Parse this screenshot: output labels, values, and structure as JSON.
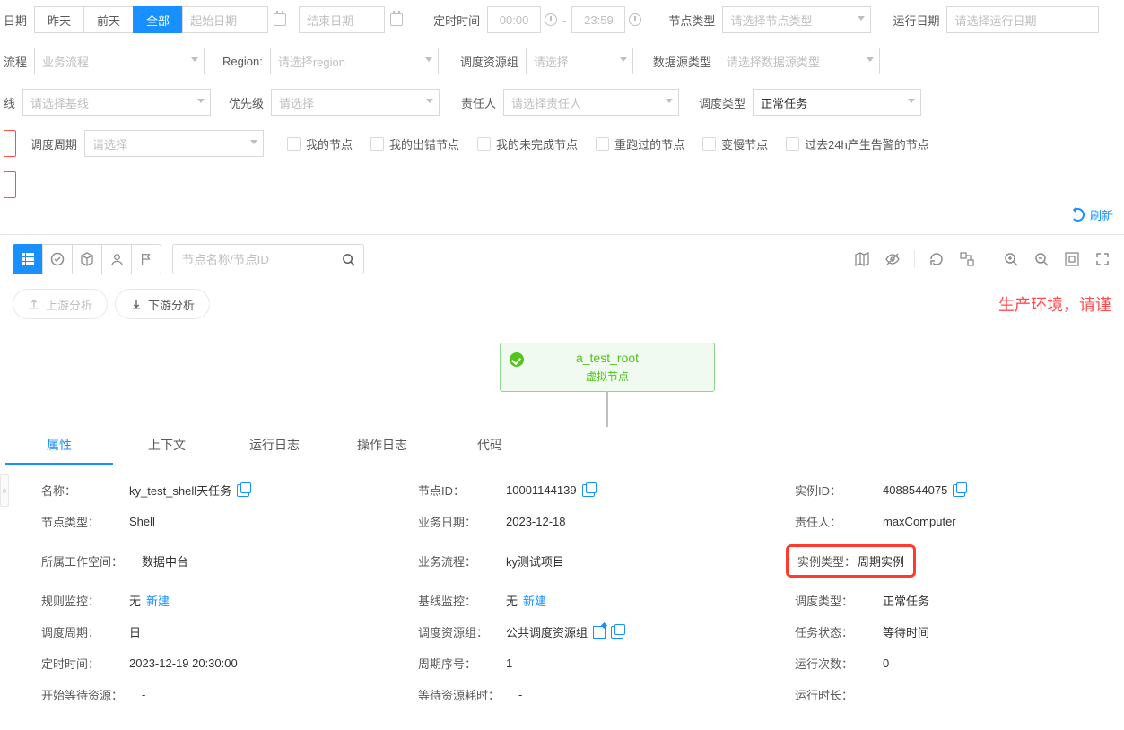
{
  "filters": {
    "date_label": "日期",
    "yesterday": "昨天",
    "day_before": "前天",
    "all": "全部",
    "start_date_ph": "起始日期",
    "end_date_ph": "结束日期",
    "time_label": "定时时间",
    "time_start": "00:00",
    "time_end": "23:59",
    "node_type_label": "节点类型",
    "node_type_ph": "请选择节点类型",
    "run_date_label": "运行日期",
    "run_date_ph": "请选择运行日期",
    "flow_label": "流程",
    "flow_ph": "业务流程",
    "region_label": "Region:",
    "region_ph": "请选择region",
    "resource_group_label": "调度资源组",
    "resource_group_ph": "请选择",
    "datasource_type_label": "数据源类型",
    "datasource_type_ph": "请选择数据源类型",
    "baseline_label": "线",
    "baseline_ph": "请选择基线",
    "priority_label": "优先级",
    "priority_ph": "请选择",
    "owner_label": "责任人",
    "owner_ph": "请选择责任人",
    "schedule_type_label": "调度类型",
    "schedule_type_val": "正常任务",
    "cycle_label": "调度周期",
    "cycle_ph": "请选择",
    "chk_my_node": "我的节点",
    "chk_my_error": "我的出错节点",
    "chk_my_unfinished": "我的未完成节点",
    "chk_rerun": "重跑过的节点",
    "chk_slow": "变慢节点",
    "chk_alarm": "过去24h产生告警的节点"
  },
  "refresh": "刷新",
  "canvas": {
    "search_ph": "节点名称/节点ID",
    "upstream": "上游分析",
    "downstream": "下游分析",
    "warn": "生产环境，请谨"
  },
  "node": {
    "title": "a_test_root",
    "subtitle": "虚拟节点"
  },
  "tabs": {
    "t1": "属性",
    "t2": "上下文",
    "t3": "运行日志",
    "t4": "操作日志",
    "t5": "代码"
  },
  "detail": {
    "name_label": "名称：",
    "name": "ky_test_shell天任务",
    "node_id_label": "节点ID：",
    "node_id": "10001144139",
    "instance_id_label": "实例ID：",
    "instance_id": "4088544075",
    "node_type_label": "节点类型：",
    "node_type": "Shell",
    "biz_date_label": "业务日期：",
    "biz_date": "2023-12-18",
    "owner_label": "责任人：",
    "owner": "maxComputer",
    "workspace_label": "所属工作空间：",
    "workspace": "数据中台",
    "flow_label": "业务流程：",
    "flow": "ky测试项目",
    "instance_type_label": "实例类型：",
    "instance_type": "周期实例",
    "rule_monitor_label": "规则监控：",
    "none": "无",
    "new_link": "新建",
    "baseline_monitor_label": "基线监控：",
    "schedule_type_label2": "调度类型：",
    "schedule_type2": "正常任务",
    "cycle_label2": "调度周期：",
    "cycle2": "日",
    "resource_group_label2": "调度资源组：",
    "resource_group2": "公共调度资源组",
    "task_status_label": "任务状态：",
    "task_status": "等待时间",
    "sched_time_label": "定时时间：",
    "sched_time": "2023-12-19 20:30:00",
    "period_no_label": "周期序号：",
    "period_no": "1",
    "run_count_label": "运行次数：",
    "run_count": "0",
    "wait_start_label": "开始等待资源：",
    "dash": "-",
    "wait_cost_label": "等待资源耗时：",
    "run_time_label": "运行时长："
  }
}
